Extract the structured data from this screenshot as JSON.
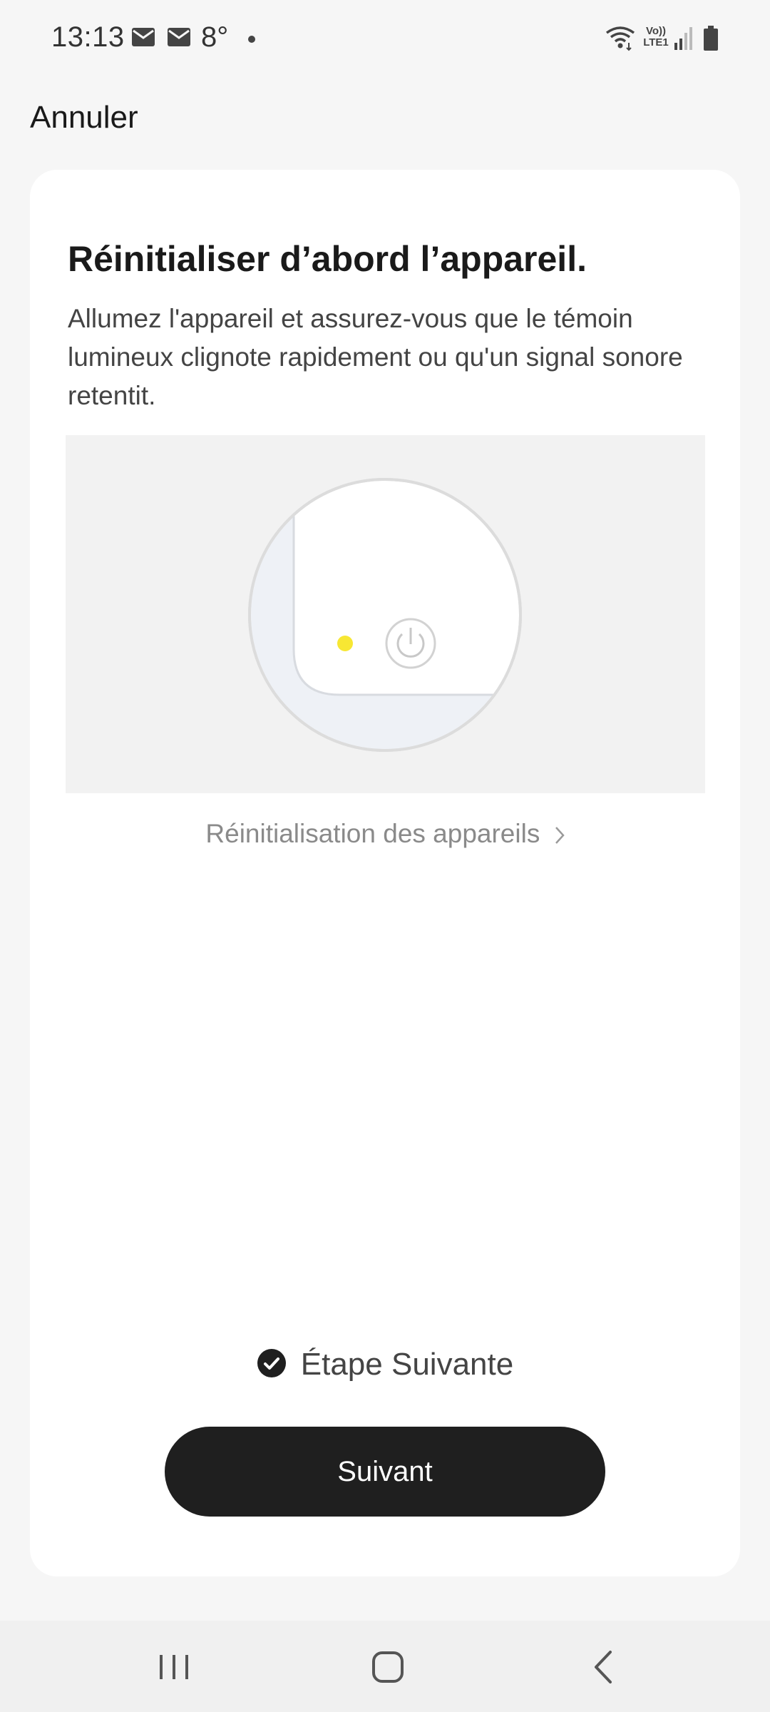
{
  "status_bar": {
    "time": "13:13",
    "temperature": "8°",
    "network_label_top": "Vo))",
    "network_label_bottom": "LTE1"
  },
  "header": {
    "cancel_label": "Annuler"
  },
  "card": {
    "title": "Réinitialiser d’abord l’appareil.",
    "description": "Allumez l'appareil et assurez-vous que le témoin lumineux clignote rapidement ou qu'un signal sonore retentit.",
    "illustration": {
      "indicator_color": "#f7e733",
      "background_color": "#f2f2f2"
    },
    "reset_link_label": "Réinitialisation des appareils",
    "next_step_label": "Étape Suivante",
    "next_button_label": "Suivant"
  },
  "nav": {
    "recent_icon": "recent-apps-icon",
    "home_icon": "home-icon",
    "back_icon": "back-icon"
  }
}
